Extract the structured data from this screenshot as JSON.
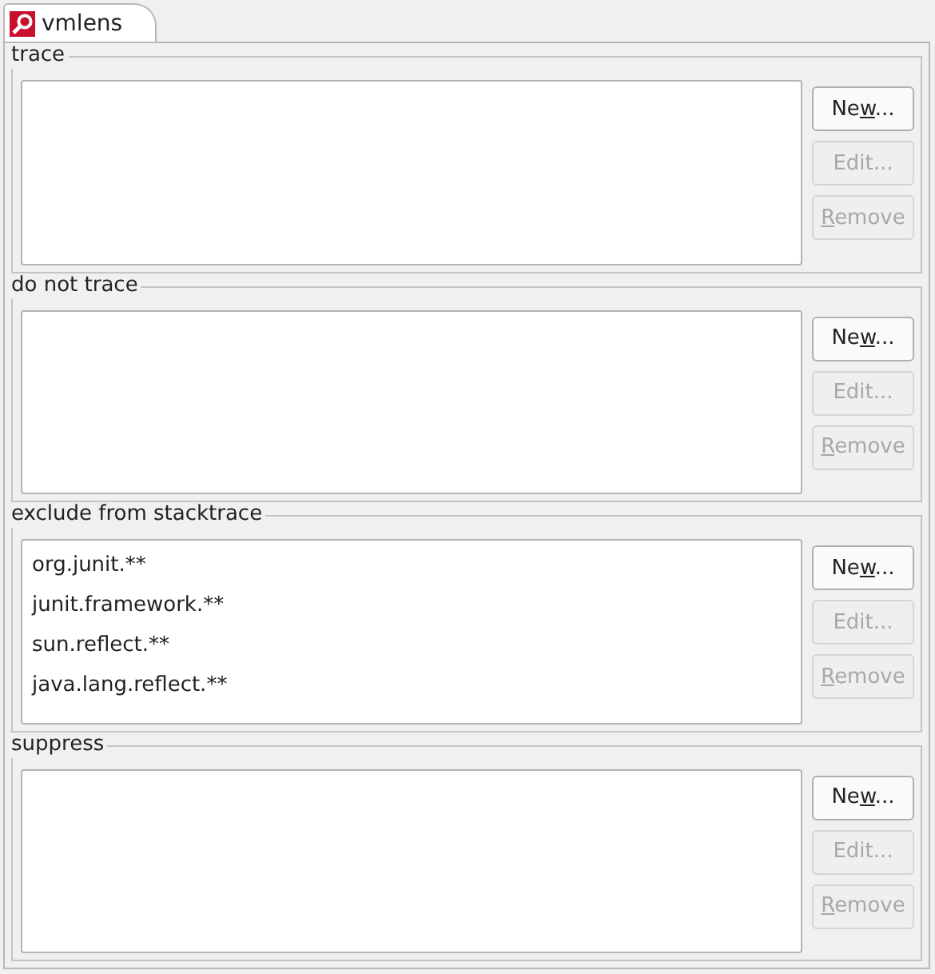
{
  "tab": {
    "label": "vmlens",
    "selected": true
  },
  "groups": [
    {
      "title": "trace",
      "buttons": [
        {
          "before": "Ne",
          "key": "w",
          "after": "...",
          "disabled": false
        },
        {
          "before": "Edit...",
          "disabled": true
        },
        {
          "key": "R",
          "after": "emove",
          "disabled": true
        }
      ]
    },
    {
      "title": "do not trace",
      "buttons": [
        {
          "before": "Ne",
          "key": "w",
          "after": "...",
          "disabled": false
        },
        {
          "before": "Edit...",
          "disabled": true
        },
        {
          "key": "R",
          "after": "emove",
          "disabled": true
        }
      ]
    },
    {
      "title": "exclude from stacktrace",
      "items": [
        "org.junit.**",
        "junit.framework.**",
        "sun.reflect.**",
        "java.lang.reflect.**"
      ],
      "buttons": [
        {
          "before": "Ne",
          "key": "w",
          "after": "...",
          "disabled": false
        },
        {
          "before": "Edit...",
          "disabled": true
        },
        {
          "key": "R",
          "after": "emove",
          "disabled": true
        }
      ]
    },
    {
      "title": "suppress",
      "buttons": [
        {
          "before": "Ne",
          "key": "w",
          "after": "...",
          "disabled": false
        },
        {
          "before": "Edit...",
          "disabled": true
        },
        {
          "key": "R",
          "after": "emove",
          "disabled": true
        }
      ]
    }
  ]
}
